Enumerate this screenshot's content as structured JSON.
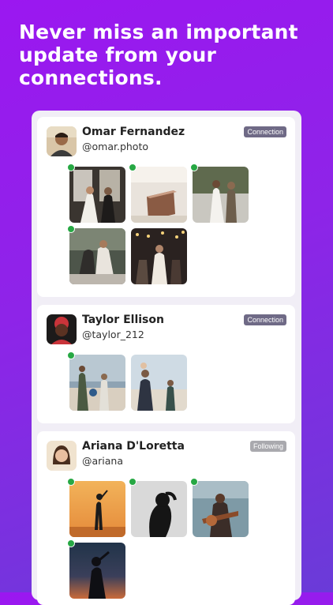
{
  "headline": "Never miss an important update from your connections.",
  "feed": [
    {
      "name": "Omar Fernandez",
      "handle": "@omar.photo",
      "badge": "Connection"
    },
    {
      "name": "Taylor Ellison",
      "handle": "@taylor_212",
      "badge": "Connection"
    },
    {
      "name": "Ariana D'Loretta",
      "handle": "@ariana",
      "badge": "Following"
    }
  ],
  "icons": {
    "new_indicator": "green-dot-icon"
  },
  "colors": {
    "new_indicator": "#27a844",
    "connection_badge": "#6f6a86",
    "following_badge": "#a9a9ae"
  }
}
